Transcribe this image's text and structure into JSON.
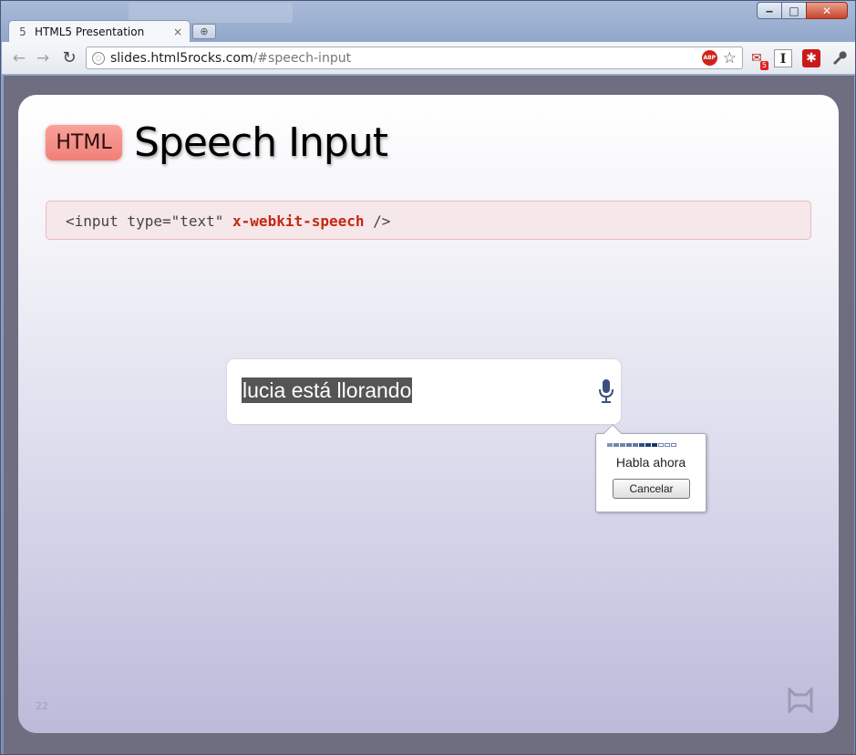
{
  "window": {
    "controls": {
      "minimize": "‒",
      "maximize": "□",
      "close": "✕"
    }
  },
  "tab": {
    "title": "HTML5 Presentation",
    "close": "×",
    "new_tab_icon": "new-tab-icon"
  },
  "toolbar": {
    "back_icon": "←",
    "forward_icon": "→",
    "reload_icon": "↻",
    "url_host": "slides.html5rocks.com",
    "url_fragment": "/#speech-input",
    "adblock_label": "ABP",
    "bookmark_icon": "☆",
    "extension_badge": "5",
    "extension_instapaper": "I",
    "extension_red": "✱",
    "wrench_icon": "🔧"
  },
  "slide": {
    "badge": "HTML",
    "title": "Speech Input",
    "code": {
      "before": "<input type=\"text\" ",
      "highlight": "x-webkit-speech",
      "after": " />"
    },
    "speech_input_value": "lucia está llorando",
    "page_number": "22"
  },
  "speech_bubble": {
    "prompt": "Habla ahora",
    "cancel_label": "Cancelar",
    "meter_levels": [
      "#7f93b4",
      "#6f86ab",
      "#6f86ab",
      "#5e78a3",
      "#5e78a3",
      "#2f4f86",
      "#1e3e78",
      "#15366f",
      "#ffffff",
      "#ffffff",
      "#ffffff"
    ]
  },
  "colors": {
    "badge_bg": "#f39089",
    "code_highlight": "#c42810",
    "code_box_bg": "#f6e7ea",
    "slide_bottom": "#bcbad9"
  }
}
